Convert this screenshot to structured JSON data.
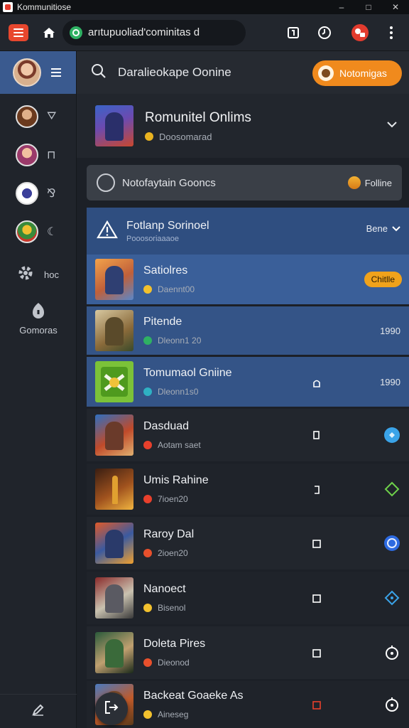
{
  "window": {
    "title": "Kommunitiose",
    "controls": [
      "–",
      "□",
      "✕"
    ]
  },
  "toolbar": {
    "url": "arıtupuoliad'cominitas d"
  },
  "sidebar": {
    "items": [
      {
        "glyph": "⛛",
        "label": ""
      },
      {
        "glyph": "⊓",
        "label": ""
      },
      {
        "glyph": "⅋",
        "label": ""
      },
      {
        "glyph": "☾",
        "label": ""
      },
      {
        "glyph": "",
        "label": "hoc"
      },
      {
        "glyph": "",
        "label": "Gomoras"
      }
    ]
  },
  "search": {
    "text": "Daralieokape Oonine"
  },
  "notify_button": {
    "label": "Notomigas"
  },
  "featured": {
    "title": "Romunitel Onlims",
    "subtitle": "Doosomarad"
  },
  "notice": {
    "text": "Notofaytain Gooncs",
    "right_label": "Folline"
  },
  "section": {
    "title": "Fotlanp Sorinoel",
    "subtitle": "Pooosoriaaaoe",
    "sort_label": "Bene"
  },
  "games": [
    {
      "name": "Satiolres",
      "sub": "Daennt00",
      "tag": "Chitlle",
      "value": ""
    },
    {
      "name": "Pitende",
      "sub": "Dleonn1 20",
      "tag": "",
      "value": "1990"
    },
    {
      "name": "Tomumaol Gniine",
      "sub": "Dleonn1s0",
      "tag": "",
      "value": "1990"
    },
    {
      "name": "Dasduad",
      "sub": "Aotam saet",
      "tag": "",
      "value": ""
    },
    {
      "name": "Umis Rahine",
      "sub": "7ioen20",
      "tag": "",
      "value": ""
    },
    {
      "name": "Raroy Dal",
      "sub": "2ioen20",
      "tag": "",
      "value": ""
    },
    {
      "name": "Nanoect",
      "sub": "Bisenol",
      "tag": "",
      "value": ""
    },
    {
      "name": "Doleta Pires",
      "sub": "Dieonod",
      "tag": "",
      "value": ""
    },
    {
      "name": "Backeat Goaeke As",
      "sub": "Aineseg",
      "tag": "",
      "value": ""
    }
  ],
  "colors": {
    "accent_orange": "#f08a1d",
    "selection_blue": "#2f4e80",
    "row_selected": "#3a5f99",
    "tag_amber": "#f0a21b"
  }
}
